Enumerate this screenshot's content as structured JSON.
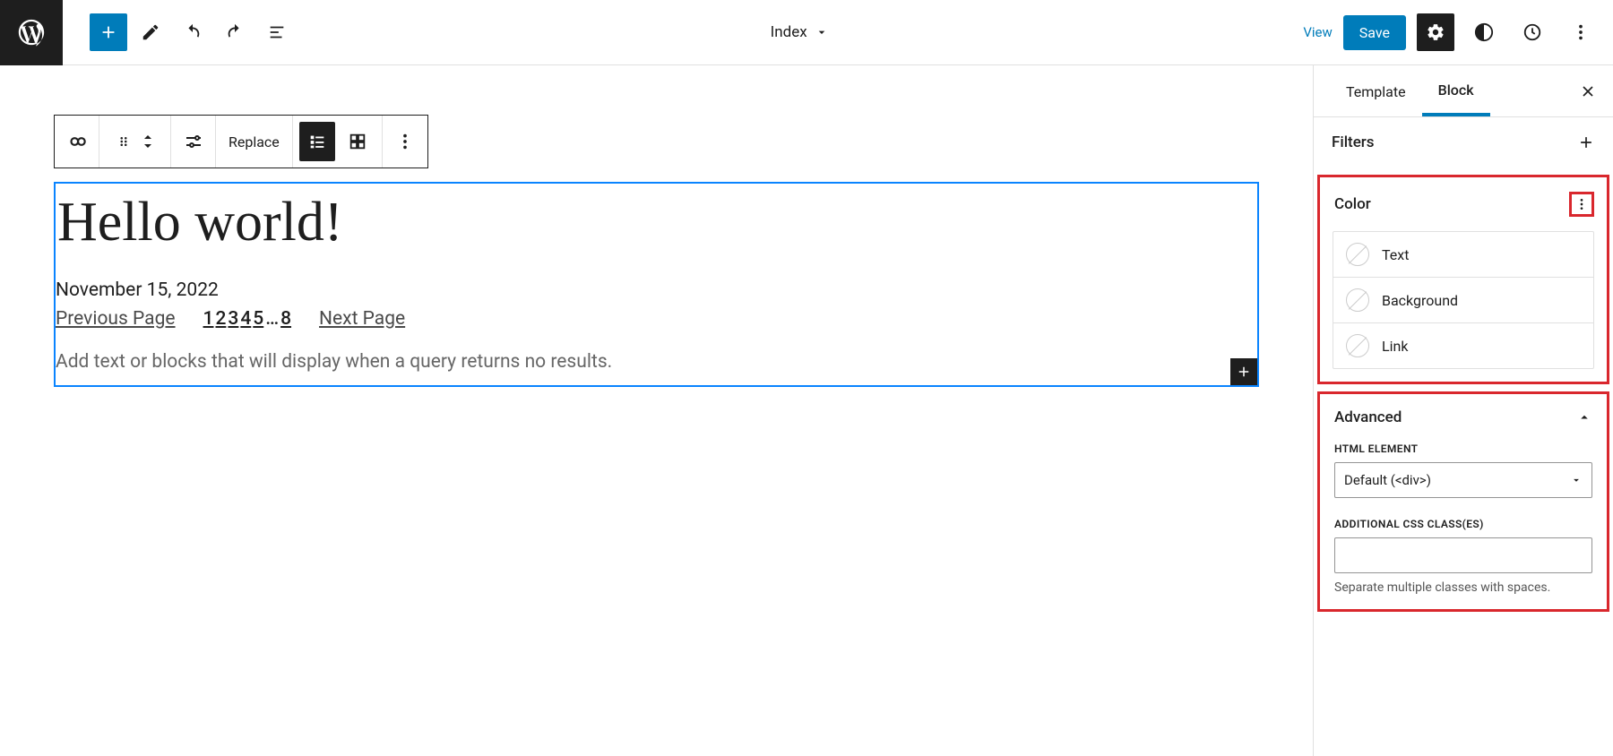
{
  "topbar": {
    "center_title": "Index",
    "view_label": "View",
    "save_label": "Save"
  },
  "block_toolbar": {
    "replace_label": "Replace"
  },
  "post": {
    "title": "Hello world!",
    "date": "November 15, 2022",
    "prev_label": "Previous Page",
    "pages": [
      "1",
      "2",
      "3",
      "4",
      "5",
      "…",
      "8"
    ],
    "next_label": "Next Page",
    "no_results_placeholder": "Add text or blocks that will display when a query returns no results."
  },
  "sidebar": {
    "tabs": {
      "template": "Template",
      "block": "Block"
    },
    "filters_label": "Filters",
    "color": {
      "heading": "Color",
      "text": "Text",
      "background": "Background",
      "link": "Link"
    },
    "advanced": {
      "heading": "Advanced",
      "html_element_label": "HTML ELEMENT",
      "html_element_value": "Default (<div>)",
      "css_label": "ADDITIONAL CSS CLASS(ES)",
      "css_help": "Separate multiple classes with spaces."
    }
  }
}
